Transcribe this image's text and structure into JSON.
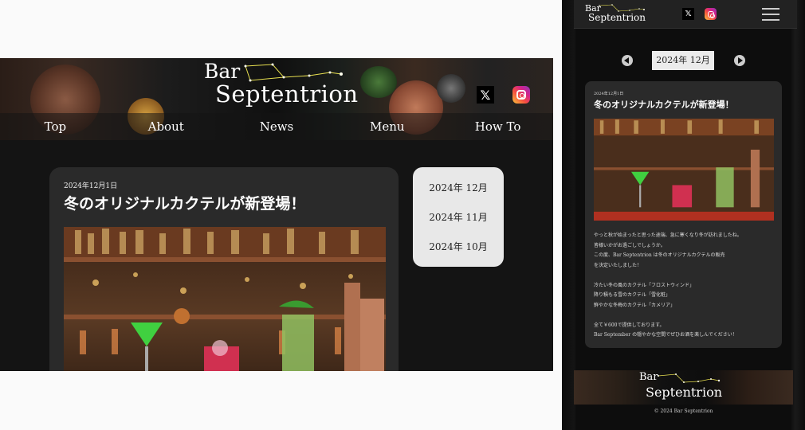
{
  "brand": {
    "bar": "Bar",
    "septentrion": "Septentrion"
  },
  "social": {
    "x_glyph": "𝕏"
  },
  "colors": {
    "accent": "#e8e8e8",
    "card": "#2a2a2a",
    "page_bg": "#141414"
  },
  "nav": {
    "items": [
      {
        "label": "Top"
      },
      {
        "label": "About"
      },
      {
        "label": "News"
      },
      {
        "label": "Menu"
      },
      {
        "label": "How To"
      }
    ]
  },
  "post": {
    "date": "2024年12月1日",
    "title": "冬のオリジナルカクテルが新登場！",
    "body": [
      "やっと秋が始まったと思った途端、急に寒くなり冬が訪れましたね。",
      "皆様いかがお過ごしでしょうか。",
      "この度、Bar Septentrion は冬のオリジナルカクテルの販売",
      "を決定いたしました！",
      "",
      "冷たい冬の風のカクテル「フロストウィンド」",
      "降り積もる雪のカクテル「雪化粧」",
      "鮮やかな冬梅のカクテル「カメリア」",
      "",
      "全て￥600で提供しております。",
      "Bar September の穏やかな空間でぜひお酒を楽しんでください！"
    ]
  },
  "archive": {
    "months": [
      {
        "label": "2024年 12月"
      },
      {
        "label": "2024年 11月"
      },
      {
        "label": "2024年 10月"
      }
    ]
  },
  "mobile": {
    "current_month": "2024年 12月",
    "copyright": "© 2024 Bar Septentrion"
  }
}
